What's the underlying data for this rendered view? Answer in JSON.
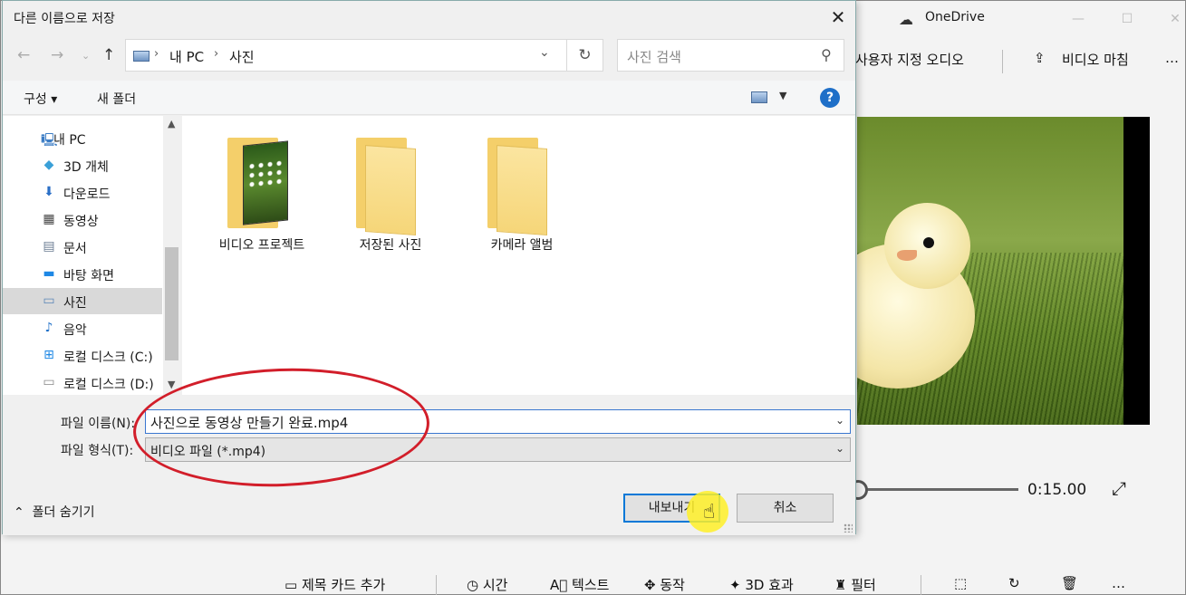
{
  "background_app": {
    "title": "OneDrive",
    "toolbar": {
      "custom_audio": "사용자 지정 오디오",
      "finish_video": "비디오 마침",
      "more": "…"
    },
    "time": "0:15.00",
    "bottom_tools": [
      {
        "icon": "title-card-icon",
        "label": "제목 카드 추가"
      },
      {
        "icon": "clock-icon",
        "label": "시간"
      },
      {
        "icon": "text-icon",
        "label": "텍스트"
      },
      {
        "icon": "motion-icon",
        "label": "동작"
      },
      {
        "icon": "3d-effects-icon",
        "label": "3D 효과"
      },
      {
        "icon": "filter-icon",
        "label": "필터"
      }
    ]
  },
  "dialog": {
    "title": "다른 이름으로 저장",
    "address": {
      "segments": [
        "내 PC",
        "사진"
      ]
    },
    "search_placeholder": "사진 검색",
    "commands": {
      "organize": "구성",
      "new_folder": "새 폴더"
    },
    "nav_items": [
      {
        "icon": "pc-icon",
        "label": "내 PC"
      },
      {
        "icon": "3d-objects-icon",
        "label": "3D 개체"
      },
      {
        "icon": "download-icon",
        "label": "다운로드"
      },
      {
        "icon": "video-icon",
        "label": "동영상"
      },
      {
        "icon": "document-icon",
        "label": "문서"
      },
      {
        "icon": "desktop-icon",
        "label": "바탕 화면"
      },
      {
        "icon": "pictures-icon",
        "label": "사진",
        "selected": true
      },
      {
        "icon": "music-icon",
        "label": "음악"
      },
      {
        "icon": "drive-c-icon",
        "label": "로컬 디스크 (C:)"
      },
      {
        "icon": "drive-d-icon",
        "label": "로컬 디스크 (D:)"
      }
    ],
    "folders": [
      {
        "name": "비디오 프로젝트",
        "has_preview": true
      },
      {
        "name": "저장된 사진",
        "has_preview": false
      },
      {
        "name": "카메라 앨범",
        "has_preview": false
      }
    ],
    "file_name_label": "파일 이름(N):",
    "file_name_value": "사진으로 동영상 만들기 완료.mp4",
    "file_type_label": "파일 형식(T):",
    "file_type_value": "비디오 파일 (*.mp4)",
    "hide_folders": "폴더 숨기기",
    "export_button": "내보내기",
    "cancel_button": "취소"
  },
  "colors": {
    "accent": "#0078d7",
    "annotation": "#d21e2a",
    "cursor_highlight": "#fff028"
  }
}
